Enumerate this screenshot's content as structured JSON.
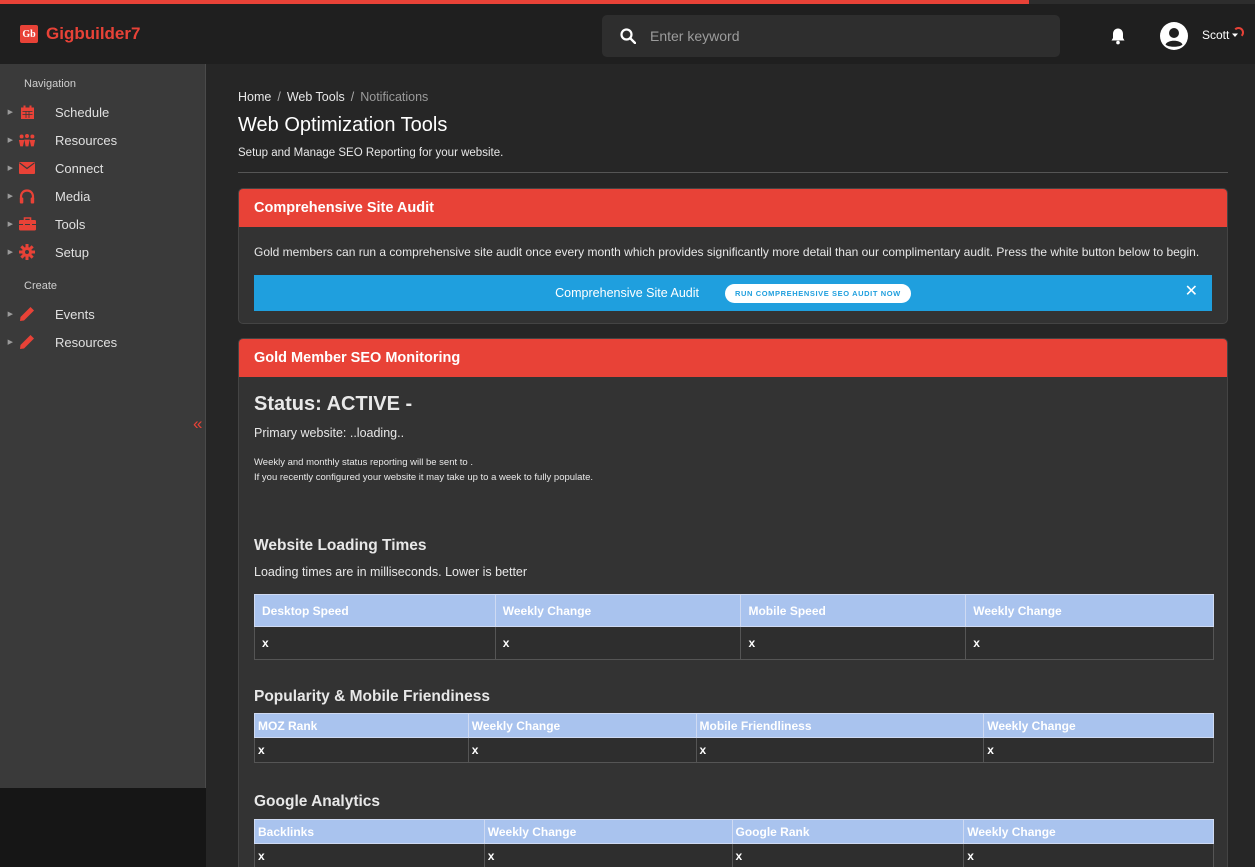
{
  "app": {
    "name": "Gigbuilder7",
    "logo_text": "Gb",
    "accent": "#e84237",
    "load_progress": 0.82
  },
  "header": {
    "search_placeholder": "Enter keyword",
    "user_name": "Scott"
  },
  "sidebar": {
    "nav_heading": "Navigation",
    "nav_items": [
      {
        "label": "Schedule",
        "icon": "calendar-icon"
      },
      {
        "label": "Resources",
        "icon": "people-icon"
      },
      {
        "label": "Connect",
        "icon": "envelope-icon"
      },
      {
        "label": "Media",
        "icon": "headphones-icon"
      },
      {
        "label": "Tools",
        "icon": "toolbox-icon"
      },
      {
        "label": "Setup",
        "icon": "gear-icon"
      }
    ],
    "create_heading": "Create",
    "create_items": [
      {
        "label": "Events",
        "icon": "pencil-icon"
      },
      {
        "label": "Resources",
        "icon": "pencil-icon"
      }
    ],
    "collapse_glyph": "«"
  },
  "breadcrumb": {
    "home": "Home",
    "section": "Web Tools",
    "current": "Notifications",
    "sep": "/"
  },
  "page": {
    "title": "Web Optimization Tools",
    "subtitle": "Setup and Manage SEO Reporting for your website."
  },
  "audit_card": {
    "title": "Comprehensive Site Audit",
    "text": "Gold members can run a comprehensive site audit once every month which provides significantly more detail than our complimentary audit. Press the white button below to begin.",
    "banner_label": "Comprehensive Site Audit",
    "button_label": "RUN COMPREHENSIVE SEO AUDIT NOW",
    "close_glyph": "✕"
  },
  "monitor_card": {
    "title": "Gold Member SEO Monitoring",
    "status": "Status: ACTIVE -",
    "primary_website": "Primary website: ..loading..",
    "note1": "Weekly and monthly status reporting will be sent to .",
    "note2": "If you recently configured your website it may take up to a week to fully populate.",
    "loading": {
      "title": "Website Loading Times",
      "desc": "Loading times are in milliseconds. Lower is better",
      "headers": [
        "Desktop Speed",
        "Weekly Change",
        "Mobile Speed",
        "Weekly Change"
      ],
      "values": [
        "x",
        "x",
        "x",
        "x"
      ]
    },
    "popularity": {
      "title": "Popularity & Mobile Friendiness",
      "headers": [
        "MOZ Rank",
        "Weekly Change",
        "Mobile Friendliness",
        "Weekly Change"
      ],
      "values": [
        "x",
        "x",
        "x",
        "x"
      ]
    },
    "analytics": {
      "title": "Google Analytics",
      "headers": [
        "Backlinks",
        "Weekly Change",
        "Google Rank",
        "Weekly Change"
      ],
      "values": [
        "x",
        "x",
        "x",
        "x"
      ]
    }
  }
}
